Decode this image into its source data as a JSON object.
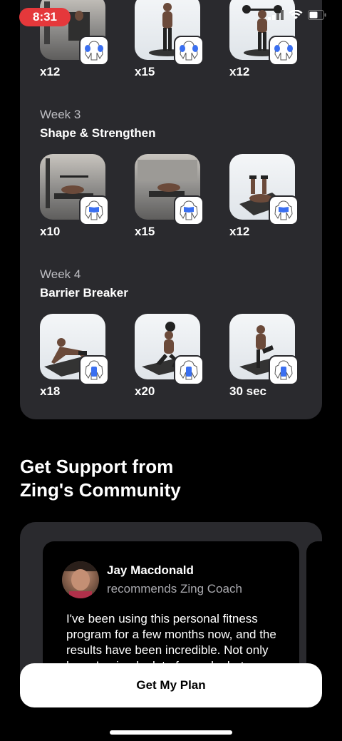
{
  "status": {
    "time": "8:31"
  },
  "program": {
    "weeks": [
      {
        "label": "",
        "title": "",
        "exercises": [
          {
            "reps": "x12",
            "muscle": "shoulders",
            "bg": "gym"
          },
          {
            "reps": "x15",
            "muscle": "shoulders",
            "bg": "studio"
          },
          {
            "reps": "x12",
            "muscle": "shoulders",
            "bg": "studio"
          }
        ]
      },
      {
        "label": "Week 3",
        "title": "Shape & Strengthen",
        "exercises": [
          {
            "reps": "x10",
            "muscle": "chest",
            "bg": "gym"
          },
          {
            "reps": "x15",
            "muscle": "chest",
            "bg": "gym"
          },
          {
            "reps": "x12",
            "muscle": "chest",
            "bg": "studio"
          }
        ]
      },
      {
        "label": "Week 4",
        "title": "Barrier Breaker",
        "exercises": [
          {
            "reps": "x18",
            "muscle": "core",
            "bg": "studio"
          },
          {
            "reps": "x20",
            "muscle": "core",
            "bg": "studio"
          },
          {
            "reps": "30 sec",
            "muscle": "core",
            "bg": "studio"
          }
        ]
      }
    ]
  },
  "support": {
    "title_line1": "Get Support from",
    "title_line2": "Zing's Community",
    "review": {
      "name": "Jay Macdonald",
      "subtitle": "recommends Zing Coach",
      "text": "I've been using this personal fitness program for a few months now, and the results have been incredible. Not only have I gained a lot of muscle, but"
    }
  },
  "cta": {
    "label": "Get My Plan"
  },
  "colors": {
    "accent_blue": "#3a6ff0",
    "status_red": "#e5383b",
    "card_bg": "#2a2a2e"
  }
}
